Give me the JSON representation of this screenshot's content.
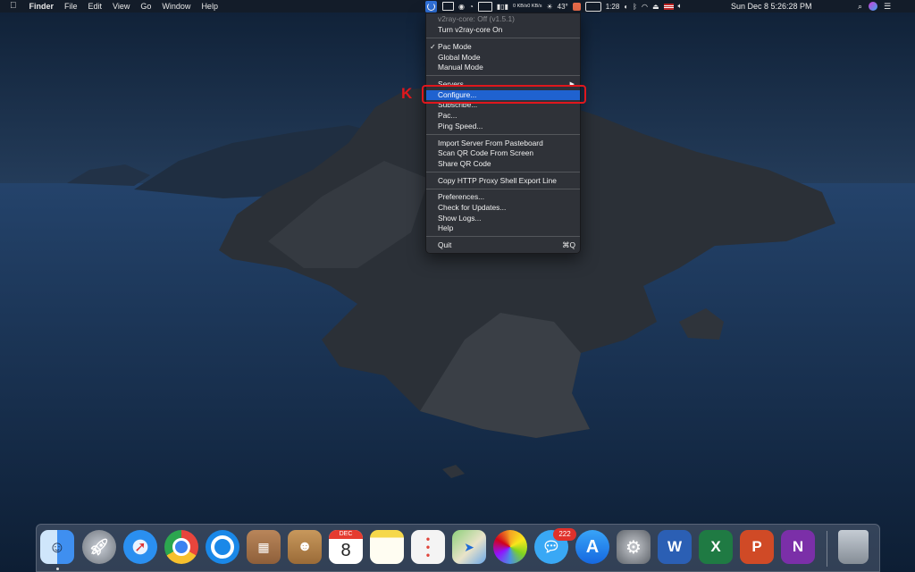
{
  "menubar": {
    "apple": "",
    "app_name": "Finder",
    "items": [
      "File",
      "Edit",
      "View",
      "Go",
      "Window",
      "Help"
    ],
    "status": {
      "net_up": "0 KB/s",
      "net_down": "0 KB/s",
      "temperature": "43°",
      "battery_time": "1:28",
      "date_time": "Sun Dec 8  5:26:28 PM"
    }
  },
  "dropdown": {
    "title": "v2ray-core: Off  (v1.5.1)",
    "turn_on": "Turn v2ray-core On",
    "checkmark": "✓",
    "modes": [
      "Pac Mode",
      "Global Mode",
      "Manual Mode"
    ],
    "servers": "Servers",
    "configure": "Configure...",
    "subscribe": "Subscribe...",
    "pac": "Pac...",
    "ping": "Ping Speed...",
    "import_server": "Import Server From Pasteboard",
    "scan_qr": "Scan QR Code From Screen",
    "share_qr": "Share QR Code",
    "copy_proxy": "Copy HTTP Proxy Shell Export Line",
    "preferences": "Preferences...",
    "check_updates": "Check for Updates...",
    "show_logs": "Show Logs...",
    "help": "Help",
    "quit": "Quit",
    "quit_shortcut": "⌘Q"
  },
  "annotation": {
    "label": "K",
    "color": "#e0171d"
  },
  "dock": {
    "mail_badge": "222",
    "calendar_month": "DEC",
    "calendar_day": "8",
    "apps": [
      {
        "name": "finder-icon",
        "color": "#3f9bf0"
      },
      {
        "name": "launchpad-icon",
        "color": "#8d9299"
      },
      {
        "name": "safari-icon",
        "color": "#2a8ff0"
      },
      {
        "name": "chrome-icon",
        "color": "#e8453c"
      },
      {
        "name": "quicktime-icon",
        "color": "#1a88e8"
      },
      {
        "name": "calculator-icon",
        "color": "#b9865a"
      },
      {
        "name": "contacts-icon",
        "color": "#b88a55"
      },
      {
        "name": "calendar-icon",
        "color": "#ffffff"
      },
      {
        "name": "notes-icon",
        "color": "#f6d84a"
      },
      {
        "name": "reminders-icon",
        "color": "#f4f4f4"
      },
      {
        "name": "maps-icon",
        "color": "#6fbf6a"
      },
      {
        "name": "photos-icon",
        "color": "#f5f5f5"
      },
      {
        "name": "messages-icon",
        "color": "#39a8f5"
      },
      {
        "name": "app-store-icon",
        "color": "#1e8df0"
      },
      {
        "name": "system-preferences-icon",
        "color": "#8b8f95"
      },
      {
        "name": "word-icon",
        "color": "#2b5fb4"
      },
      {
        "name": "excel-icon",
        "color": "#1f7a43"
      },
      {
        "name": "powerpoint-icon",
        "color": "#d04a26"
      },
      {
        "name": "onenote-icon",
        "color": "#7b2fa8"
      },
      {
        "name": "trash-icon",
        "color": "#9aa3ad"
      }
    ]
  }
}
